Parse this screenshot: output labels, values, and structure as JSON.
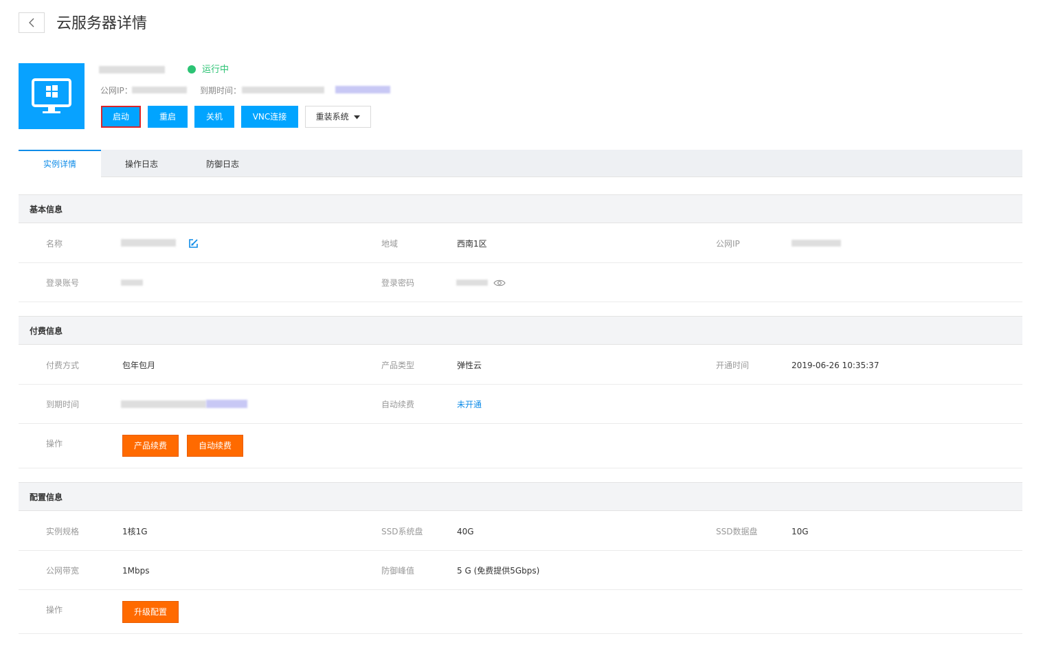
{
  "header": {
    "title": "云服务器详情"
  },
  "instance": {
    "status": "运行中",
    "public_ip_label": "公网IP：",
    "expire_label": "到期时间："
  },
  "actions": {
    "start": "启动",
    "restart": "重启",
    "shutdown": "关机",
    "vnc": "VNC连接",
    "reinstall": "重装系统"
  },
  "tabs": [
    {
      "label": "实例详情",
      "active": true
    },
    {
      "label": "操作日志",
      "active": false
    },
    {
      "label": "防御日志",
      "active": false
    }
  ],
  "basic": {
    "title": "基本信息",
    "name_label": "名称",
    "region_label": "地域",
    "region_value": "西南1区",
    "public_ip_label": "公网IP",
    "login_account_label": "登录账号",
    "login_password_label": "登录密码"
  },
  "billing": {
    "title": "付费信息",
    "pay_method_label": "付费方式",
    "pay_method_value": "包年包月",
    "product_type_label": "产品类型",
    "product_type_value": "弹性云",
    "open_time_label": "开通时间",
    "open_time_value": "2019-06-26 10:35:37",
    "expire_label": "到期时间",
    "auto_renew_label": "自动续费",
    "auto_renew_value": "未开通",
    "ops_label": "操作",
    "renew_button": "产品续费",
    "auto_renew_button": "自动续费"
  },
  "config": {
    "title": "配置信息",
    "spec_label": "实例规格",
    "spec_value": "1核1G",
    "ssd_sys_label": "SSD系统盘",
    "ssd_sys_value": "40G",
    "ssd_data_label": "SSD数据盘",
    "ssd_data_value": "10G",
    "bandwidth_label": "公网带宽",
    "bandwidth_value": "1Mbps",
    "defense_label": "防御峰值",
    "defense_value": "5 G (免费提供5Gbps)",
    "ops_label": "操作",
    "upgrade_button": "升级配置"
  },
  "colors": {
    "accent_blue": "#01a4ff",
    "link_blue": "#0f8ce8",
    "running_green": "#2cc374",
    "orange": "#ff6a00",
    "highlight_red": "#d9252a"
  }
}
